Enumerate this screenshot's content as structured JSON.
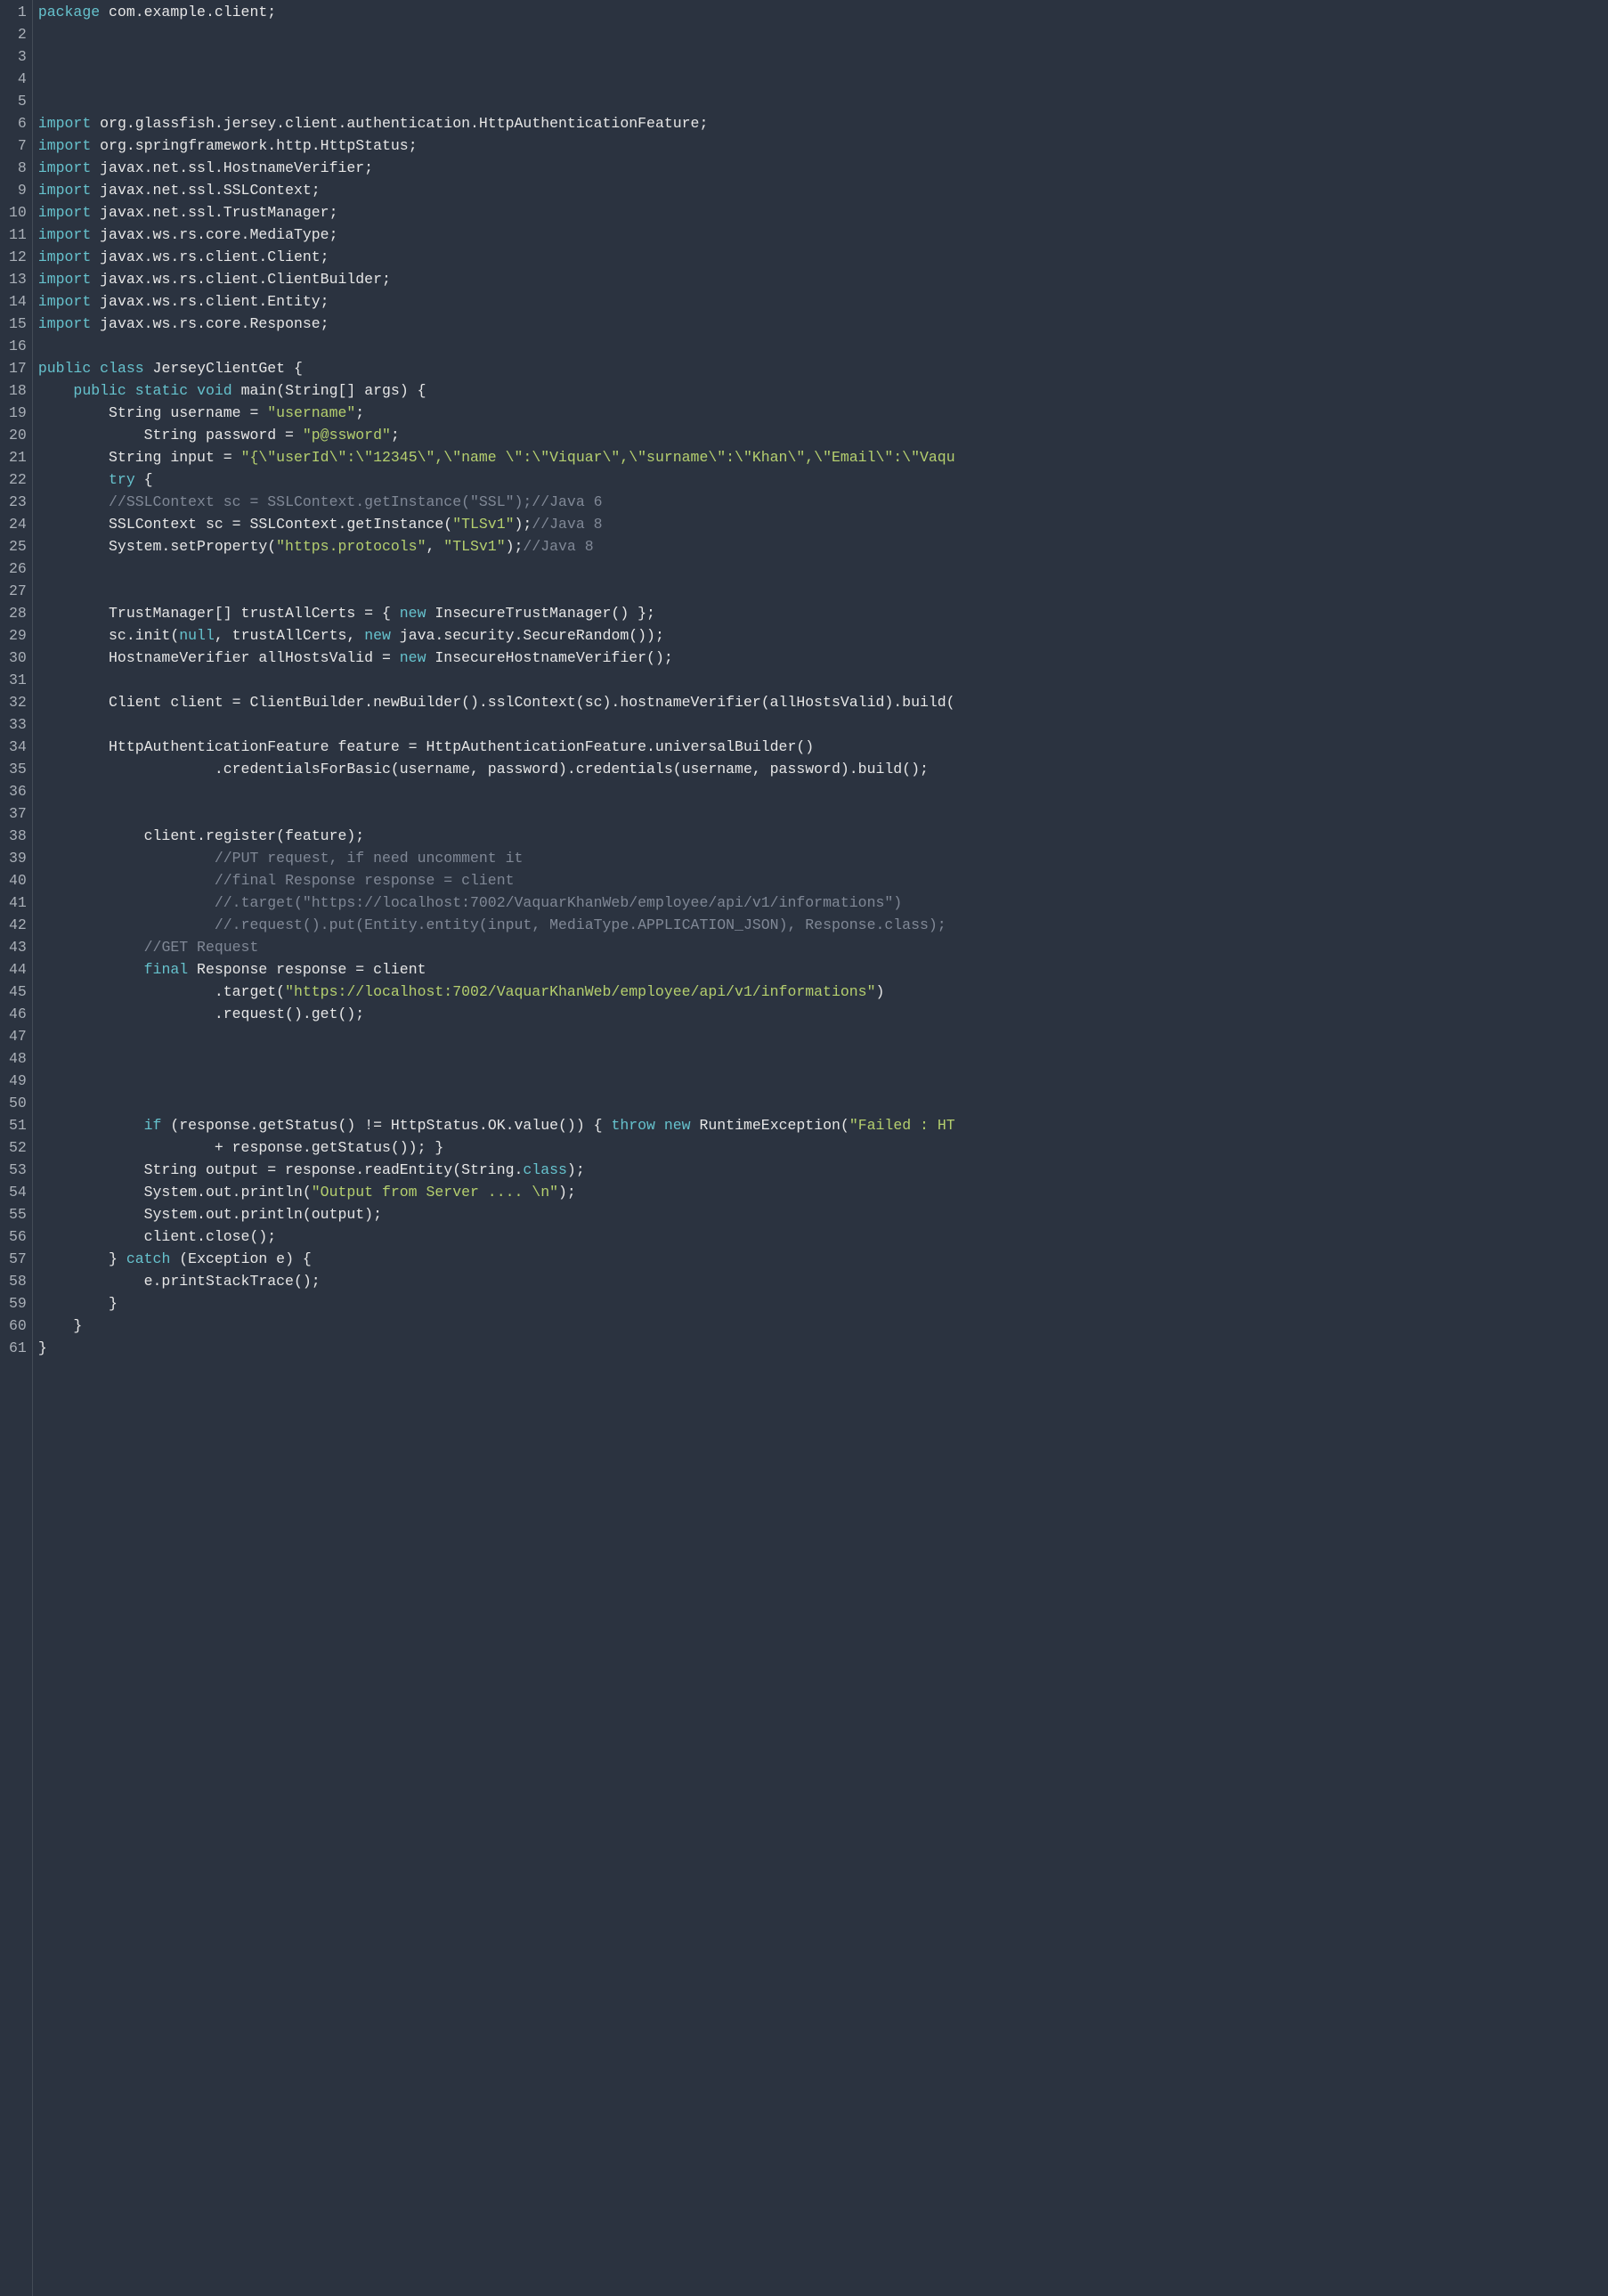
{
  "lines": [
    {
      "n": 1,
      "tokens": [
        [
          "kw",
          "package"
        ],
        [
          "plain",
          " com.example.client;"
        ]
      ]
    },
    {
      "n": 2,
      "tokens": []
    },
    {
      "n": 3,
      "tokens": []
    },
    {
      "n": 4,
      "tokens": []
    },
    {
      "n": 5,
      "tokens": []
    },
    {
      "n": 6,
      "tokens": [
        [
          "kw",
          "import"
        ],
        [
          "plain",
          " org.glassfish.jersey.client.authentication.HttpAuthenticationFeature;"
        ]
      ]
    },
    {
      "n": 7,
      "tokens": [
        [
          "kw",
          "import"
        ],
        [
          "plain",
          " org.springframework.http.HttpStatus;"
        ]
      ]
    },
    {
      "n": 8,
      "tokens": [
        [
          "kw",
          "import"
        ],
        [
          "plain",
          " javax.net.ssl.HostnameVerifier;"
        ]
      ]
    },
    {
      "n": 9,
      "tokens": [
        [
          "kw",
          "import"
        ],
        [
          "plain",
          " javax.net.ssl.SSLContext;"
        ]
      ]
    },
    {
      "n": 10,
      "tokens": [
        [
          "kw",
          "import"
        ],
        [
          "plain",
          " javax.net.ssl.TrustManager;"
        ]
      ]
    },
    {
      "n": 11,
      "tokens": [
        [
          "kw",
          "import"
        ],
        [
          "plain",
          " javax.ws.rs.core.MediaType;"
        ]
      ]
    },
    {
      "n": 12,
      "tokens": [
        [
          "kw",
          "import"
        ],
        [
          "plain",
          " javax.ws.rs.client.Client;"
        ]
      ]
    },
    {
      "n": 13,
      "tokens": [
        [
          "kw",
          "import"
        ],
        [
          "plain",
          " javax.ws.rs.client.ClientBuilder;"
        ]
      ]
    },
    {
      "n": 14,
      "tokens": [
        [
          "kw",
          "import"
        ],
        [
          "plain",
          " javax.ws.rs.client.Entity;"
        ]
      ]
    },
    {
      "n": 15,
      "tokens": [
        [
          "kw",
          "import"
        ],
        [
          "plain",
          " javax.ws.rs.core.Response;"
        ]
      ]
    },
    {
      "n": 16,
      "tokens": []
    },
    {
      "n": 17,
      "tokens": [
        [
          "kw",
          "public"
        ],
        [
          "plain",
          " "
        ],
        [
          "kw",
          "class"
        ],
        [
          "plain",
          " JerseyClientGet {"
        ]
      ]
    },
    {
      "n": 18,
      "tokens": [
        [
          "plain",
          "    "
        ],
        [
          "kw",
          "public"
        ],
        [
          "plain",
          " "
        ],
        [
          "kw",
          "static"
        ],
        [
          "plain",
          " "
        ],
        [
          "kw",
          "void"
        ],
        [
          "plain",
          " main(String[] args) {"
        ]
      ]
    },
    {
      "n": 19,
      "tokens": [
        [
          "plain",
          "        String username = "
        ],
        [
          "str",
          "\"username\""
        ],
        [
          "plain",
          ";"
        ]
      ]
    },
    {
      "n": 20,
      "tokens": [
        [
          "plain",
          "            String password = "
        ],
        [
          "str",
          "\"p@ssword\""
        ],
        [
          "plain",
          ";"
        ]
      ]
    },
    {
      "n": 21,
      "tokens": [
        [
          "plain",
          "        String input = "
        ],
        [
          "str",
          "\"{\\\"userId\\\":\\\"12345\\\",\\\"name \\\":\\\"Viquar\\\",\\\"surname\\\":\\\"Khan\\\",\\\"Email\\\":\\\"Vaqu"
        ]
      ]
    },
    {
      "n": 22,
      "tokens": [
        [
          "plain",
          "        "
        ],
        [
          "kw",
          "try"
        ],
        [
          "plain",
          " {"
        ]
      ]
    },
    {
      "n": 23,
      "tokens": [
        [
          "plain",
          "        "
        ],
        [
          "cmt",
          "//SSLContext sc = SSLContext.getInstance(\"SSL\");//Java 6"
        ]
      ]
    },
    {
      "n": 24,
      "tokens": [
        [
          "plain",
          "        SSLContext sc = SSLContext.getInstance("
        ],
        [
          "str",
          "\"TLSv1\""
        ],
        [
          "plain",
          ");"
        ],
        [
          "cmt",
          "//Java 8"
        ]
      ]
    },
    {
      "n": 25,
      "tokens": [
        [
          "plain",
          "        System.setProperty("
        ],
        [
          "str",
          "\"https.protocols\""
        ],
        [
          "plain",
          ", "
        ],
        [
          "str",
          "\"TLSv1\""
        ],
        [
          "plain",
          ");"
        ],
        [
          "cmt",
          "//Java 8"
        ]
      ]
    },
    {
      "n": 26,
      "tokens": []
    },
    {
      "n": 27,
      "tokens": []
    },
    {
      "n": 28,
      "tokens": [
        [
          "plain",
          "        TrustManager[] trustAllCerts = { "
        ],
        [
          "kw",
          "new"
        ],
        [
          "plain",
          " InsecureTrustManager() };"
        ]
      ]
    },
    {
      "n": 29,
      "tokens": [
        [
          "plain",
          "        sc.init("
        ],
        [
          "kw",
          "null"
        ],
        [
          "plain",
          ", trustAllCerts, "
        ],
        [
          "kw",
          "new"
        ],
        [
          "plain",
          " java.security.SecureRandom());"
        ]
      ]
    },
    {
      "n": 30,
      "tokens": [
        [
          "plain",
          "        HostnameVerifier allHostsValid = "
        ],
        [
          "kw",
          "new"
        ],
        [
          "plain",
          " InsecureHostnameVerifier();"
        ]
      ]
    },
    {
      "n": 31,
      "tokens": []
    },
    {
      "n": 32,
      "tokens": [
        [
          "plain",
          "        Client client = ClientBuilder.newBuilder().sslContext(sc).hostnameVerifier(allHostsValid).build("
        ]
      ]
    },
    {
      "n": 33,
      "tokens": []
    },
    {
      "n": 34,
      "tokens": [
        [
          "plain",
          "        HttpAuthenticationFeature feature = HttpAuthenticationFeature.universalBuilder()"
        ]
      ]
    },
    {
      "n": 35,
      "tokens": [
        [
          "plain",
          "                    .credentialsForBasic(username, password).credentials(username, password).build();"
        ]
      ]
    },
    {
      "n": 36,
      "tokens": []
    },
    {
      "n": 37,
      "tokens": []
    },
    {
      "n": 38,
      "tokens": [
        [
          "plain",
          "            client.register(feature);"
        ]
      ]
    },
    {
      "n": 39,
      "tokens": [
        [
          "plain",
          "                    "
        ],
        [
          "cmt",
          "//PUT request, if need uncomment it"
        ]
      ]
    },
    {
      "n": 40,
      "tokens": [
        [
          "plain",
          "                    "
        ],
        [
          "cmt",
          "//final Response response = client"
        ]
      ]
    },
    {
      "n": 41,
      "tokens": [
        [
          "plain",
          "                    "
        ],
        [
          "cmt",
          "//.target(\"https://localhost:7002/VaquarKhanWeb/employee/api/v1/informations\")"
        ]
      ]
    },
    {
      "n": 42,
      "tokens": [
        [
          "plain",
          "                    "
        ],
        [
          "cmt",
          "//.request().put(Entity.entity(input, MediaType.APPLICATION_JSON), Response.class);"
        ]
      ]
    },
    {
      "n": 43,
      "tokens": [
        [
          "plain",
          "            "
        ],
        [
          "cmt",
          "//GET Request"
        ]
      ]
    },
    {
      "n": 44,
      "tokens": [
        [
          "plain",
          "            "
        ],
        [
          "kw",
          "final"
        ],
        [
          "plain",
          " Response response = client"
        ]
      ]
    },
    {
      "n": 45,
      "tokens": [
        [
          "plain",
          "                    .target("
        ],
        [
          "str",
          "\"https://localhost:7002/VaquarKhanWeb/employee/api/v1/informations\""
        ],
        [
          "plain",
          ")"
        ]
      ]
    },
    {
      "n": 46,
      "tokens": [
        [
          "plain",
          "                    .request().get();"
        ]
      ]
    },
    {
      "n": 47,
      "tokens": []
    },
    {
      "n": 48,
      "tokens": []
    },
    {
      "n": 49,
      "tokens": []
    },
    {
      "n": 50,
      "tokens": []
    },
    {
      "n": 51,
      "tokens": [
        [
          "plain",
          "            "
        ],
        [
          "kw",
          "if"
        ],
        [
          "plain",
          " (response.getStatus() != HttpStatus.OK.value()) { "
        ],
        [
          "kw",
          "throw"
        ],
        [
          "plain",
          " "
        ],
        [
          "kw",
          "new"
        ],
        [
          "plain",
          " RuntimeException("
        ],
        [
          "str",
          "\"Failed : HT"
        ]
      ]
    },
    {
      "n": 52,
      "tokens": [
        [
          "plain",
          "                    + response.getStatus()); }"
        ]
      ]
    },
    {
      "n": 53,
      "tokens": [
        [
          "plain",
          "            String output = response.readEntity(String."
        ],
        [
          "kw",
          "class"
        ],
        [
          "plain",
          ");"
        ]
      ]
    },
    {
      "n": 54,
      "tokens": [
        [
          "plain",
          "            System.out.println("
        ],
        [
          "str",
          "\"Output from Server .... \\n\""
        ],
        [
          "plain",
          ");"
        ]
      ]
    },
    {
      "n": 55,
      "tokens": [
        [
          "plain",
          "            System.out.println(output);"
        ]
      ]
    },
    {
      "n": 56,
      "tokens": [
        [
          "plain",
          "            client.close();"
        ]
      ]
    },
    {
      "n": 57,
      "tokens": [
        [
          "plain",
          "        } "
        ],
        [
          "kw",
          "catch"
        ],
        [
          "plain",
          " (Exception e) {"
        ]
      ]
    },
    {
      "n": 58,
      "tokens": [
        [
          "plain",
          "            e.printStackTrace();"
        ]
      ]
    },
    {
      "n": 59,
      "tokens": [
        [
          "plain",
          "        }"
        ]
      ]
    },
    {
      "n": 60,
      "tokens": [
        [
          "plain",
          "    }"
        ]
      ]
    },
    {
      "n": 61,
      "tokens": [
        [
          "plain",
          "}"
        ]
      ]
    }
  ]
}
